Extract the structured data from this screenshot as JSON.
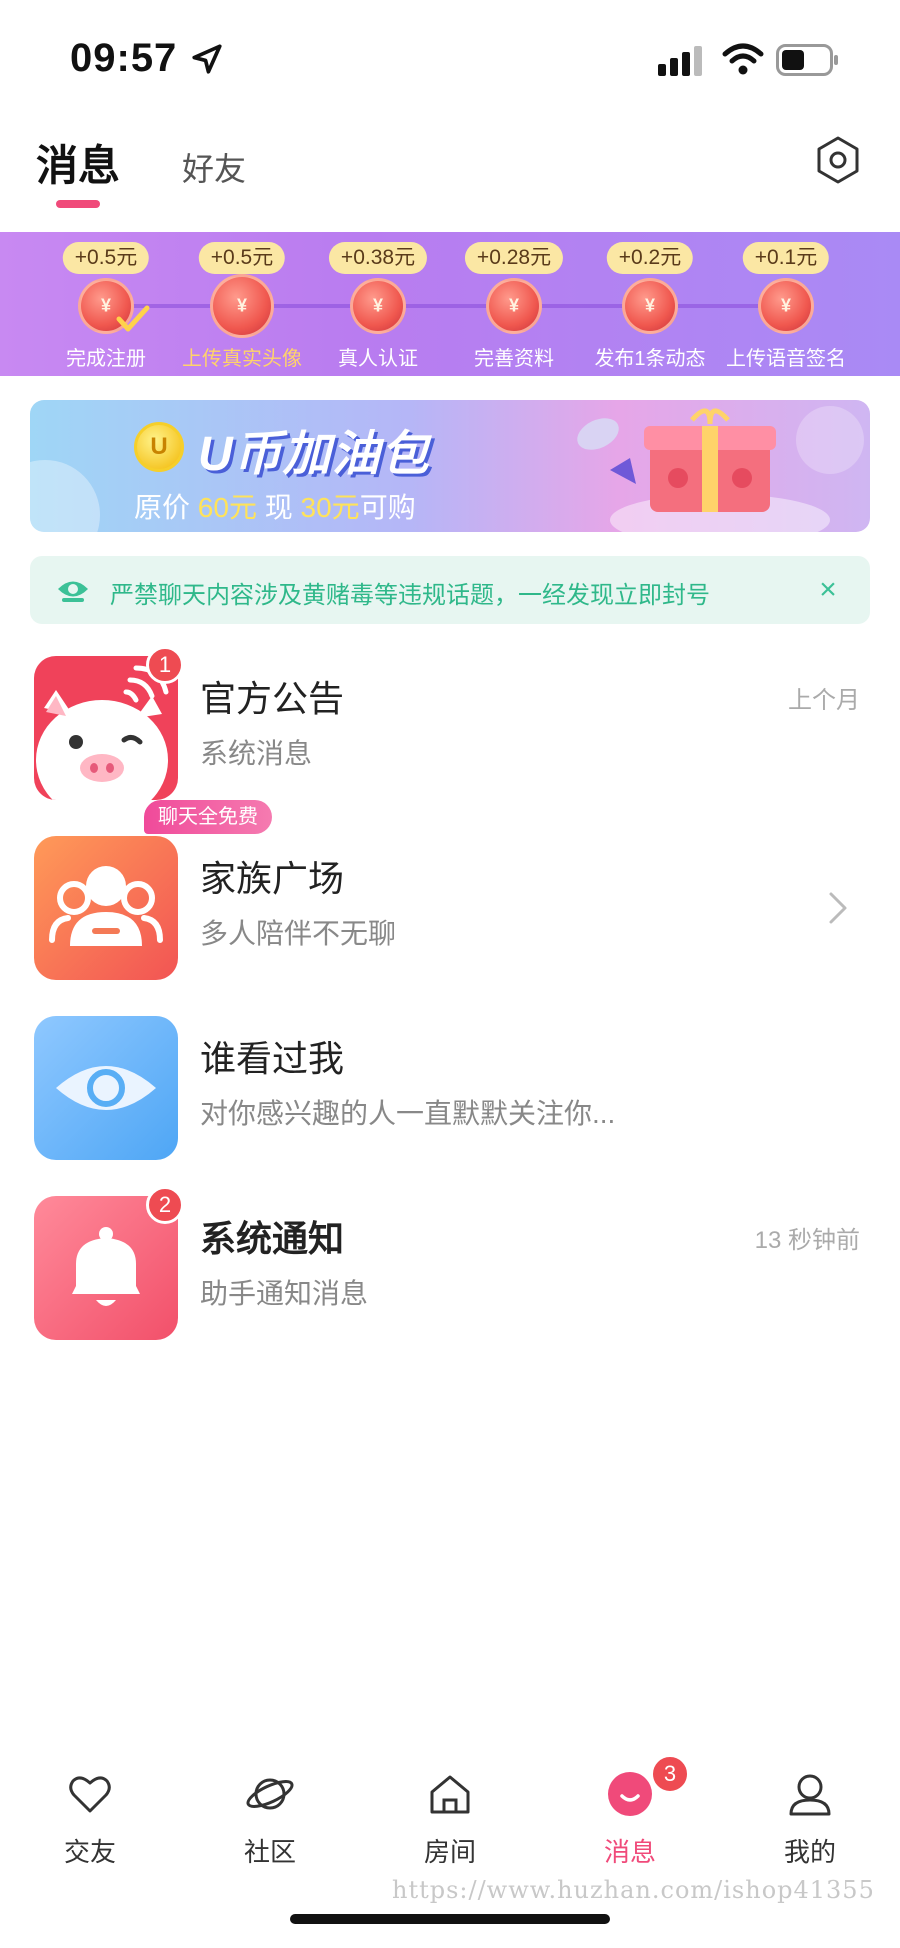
{
  "status": {
    "time": "09:57"
  },
  "header": {
    "active_tab": "消息",
    "inactive_tab": "好友"
  },
  "rewards": [
    {
      "amount": "+0.5元",
      "label": "完成注册",
      "done": true
    },
    {
      "amount": "+0.5元",
      "label": "上传真实头像",
      "current": true
    },
    {
      "amount": "+0.38元",
      "label": "真人认证"
    },
    {
      "amount": "+0.28元",
      "label": "完善资料"
    },
    {
      "amount": "+0.2元",
      "label": "发布1条动态"
    },
    {
      "amount": "+0.1元",
      "label": "上传语音签名"
    }
  ],
  "promo": {
    "coin_letter": "U",
    "title": "U币加油包",
    "sub_prefix": "原价",
    "original_price": "60元",
    "sub_mid": "现",
    "sale_price": "30元",
    "sub_suffix": "可购"
  },
  "notice": {
    "text": "严禁聊天内容涉及黄赌毒等违规话题，一经发现立即封号",
    "close": "×"
  },
  "messages": [
    {
      "title": "官方公告",
      "subtitle": "系统消息",
      "time": "上个月",
      "badge": "1"
    },
    {
      "title": "家族广场",
      "subtitle": "多人陪伴不无聊",
      "tag": "聊天全免费"
    },
    {
      "title": "谁看过我",
      "subtitle": "对你感兴趣的人一直默默关注你..."
    },
    {
      "title": "系统通知",
      "subtitle": "助手通知消息",
      "time": "13 秒钟前",
      "badge": "2"
    }
  ],
  "nav": [
    {
      "label": "交友"
    },
    {
      "label": "社区"
    },
    {
      "label": "房间"
    },
    {
      "label": "消息",
      "badge": "3",
      "active": true
    },
    {
      "label": "我的"
    }
  ],
  "colors": {
    "accent": "#f04a7a",
    "notice_green": "#2fb88a",
    "badge_red": "#ee4b52"
  },
  "watermark": "https://www.huzhan.com/ishop41355"
}
